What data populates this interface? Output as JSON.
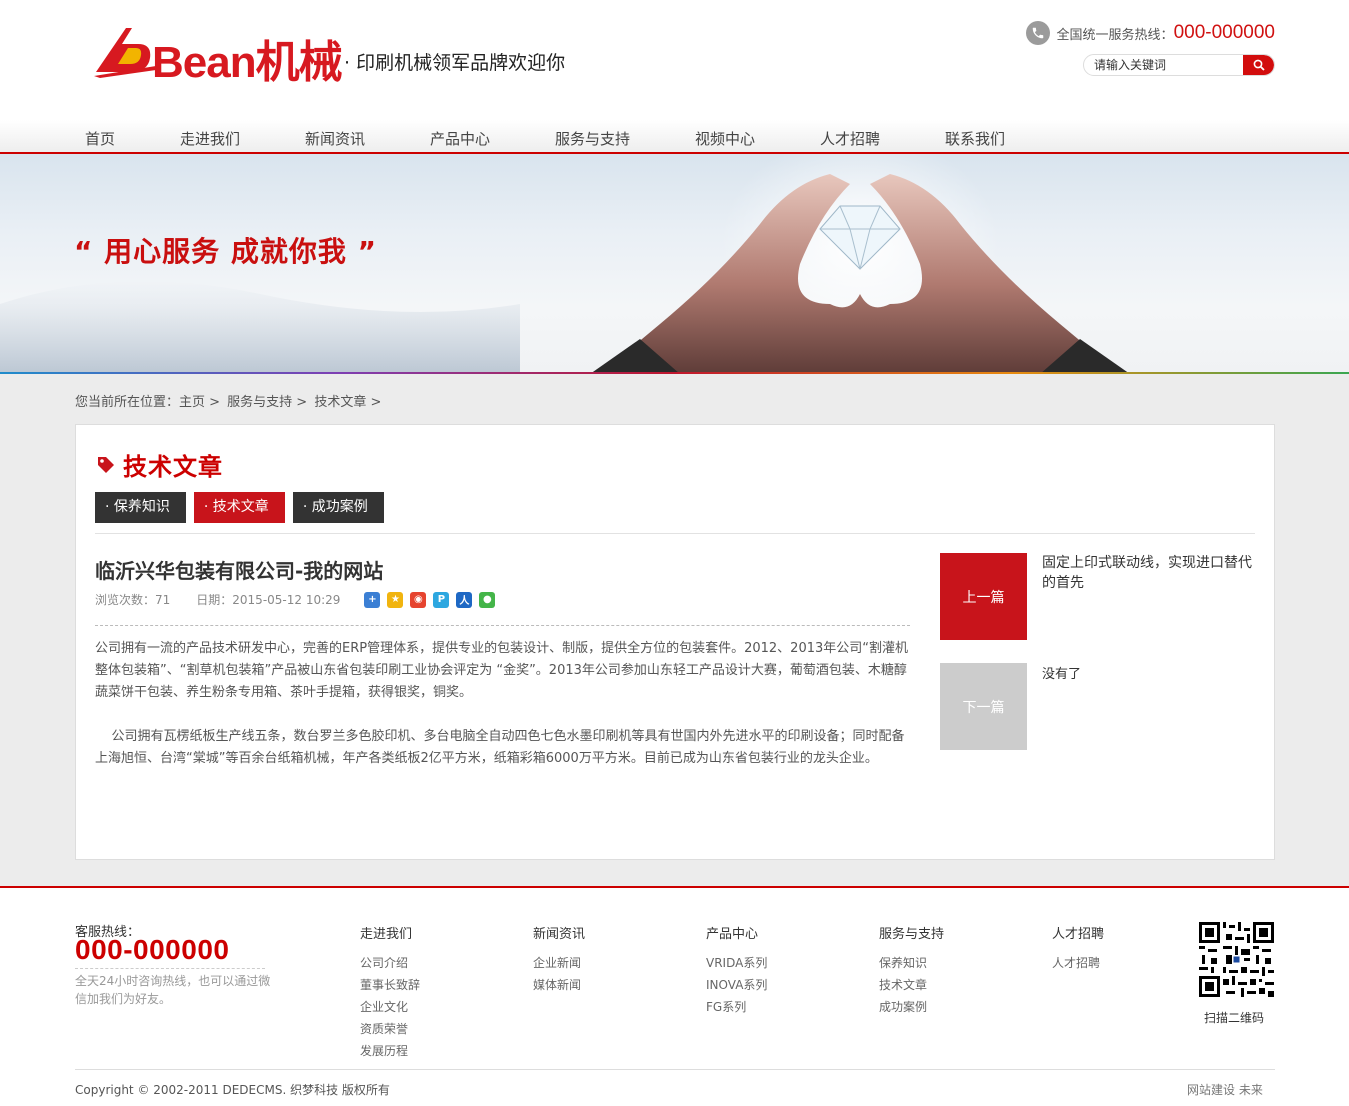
{
  "header": {
    "brand": "Bean机械",
    "slogan": "· 印刷机械领军品牌欢迎你",
    "hotline_label": "全国统一服务热线：",
    "hotline_number": "000-000000",
    "search_placeholder": "请输入关键词",
    "icons": {
      "phone": "phone-icon",
      "search": "search-icon"
    }
  },
  "nav": {
    "items": [
      "首页",
      "走进我们",
      "新闻资讯",
      "产品中心",
      "服务与支持",
      "视频中心",
      "人才招聘",
      "联系我们"
    ]
  },
  "banner": {
    "quote": "“ 用心服务  成就你我 ”"
  },
  "breadcrumb": {
    "items": [
      "您当前所在位置：主页 >",
      "服务与支持 >",
      "技术文章 >"
    ]
  },
  "section": {
    "title": "技术文章",
    "tabs": [
      "· 保养知识",
      "· 技术文章",
      "· 成功案例"
    ],
    "active_tab": 1
  },
  "article": {
    "title": "临沂兴华包装有限公司-我的网站",
    "views": "浏览次数：71",
    "date": "日期：2015-05-12 10:29",
    "share_icons": [
      "share-more-icon",
      "share-qzone-icon",
      "share-weibo-icon",
      "share-tencent-icon",
      "share-renren-icon",
      "share-wechat-icon"
    ],
    "paragraphs": [
      "公司拥有一流的产品技术研发中心，完善的ERP管理体系，提供专业的包装设计、制版，提供全方位的包装套件。2012、2013年公司“割灌机整体包装箱”、“割草机包装箱”产品被山东省包装印刷工业协会评定为 “金奖”。2013年公司参加山东轻工产品设计大赛，葡萄酒包装、木糖醇蔬菜饼干包装、养生粉条专用箱、茶叶手提箱，获得银奖，铜奖。",
      "    公司拥有瓦楞纸板生产线五条，数台罗兰多色胶印机、多台电脑全自动四色七色水墨印刷机等具有世国内外先进水平的印刷设备；同时配备上海旭恒、台湾“棠城”等百余台纸箱机械，年产各类纸板2亿平方米，纸箱彩箱6000万平方米。目前已成为山东省包装行业的龙头企业。"
    ]
  },
  "pager": {
    "prev_label": "上一篇",
    "prev_title": "固定上印式联动线，实现进口替代的首先",
    "next_label": "下一篇",
    "next_title": "没有了"
  },
  "footer": {
    "hotline_label": "客服热线：",
    "hotline_number": "000-000000",
    "note": "全天24小时咨询热线，也可以通过微信加我们为好友。",
    "columns": [
      {
        "title": "走进我们",
        "links": [
          "公司介绍",
          "董事长致辞",
          "企业文化",
          "资质荣誉",
          "发展历程"
        ]
      },
      {
        "title": "新闻资讯",
        "links": [
          "企业新闻",
          "媒体新闻"
        ]
      },
      {
        "title": "产品中心",
        "links": [
          "VRIDA系列",
          "INOVA系列",
          "FG系列"
        ]
      },
      {
        "title": "服务与支持",
        "links": [
          "保养知识",
          "技术文章",
          "成功案例"
        ]
      },
      {
        "title": "人才招聘",
        "links": [
          "人才招聘"
        ]
      }
    ],
    "qr_label": "扫描二维码",
    "copyright": "Copyright © 2002-2011 DEDECMS. 织梦科技 版权所有",
    "watermark": "网站建设 未来"
  },
  "colors": {
    "brand_red": "#c8141b",
    "dark_tab": "#333333",
    "disabled": "#cccccc"
  }
}
